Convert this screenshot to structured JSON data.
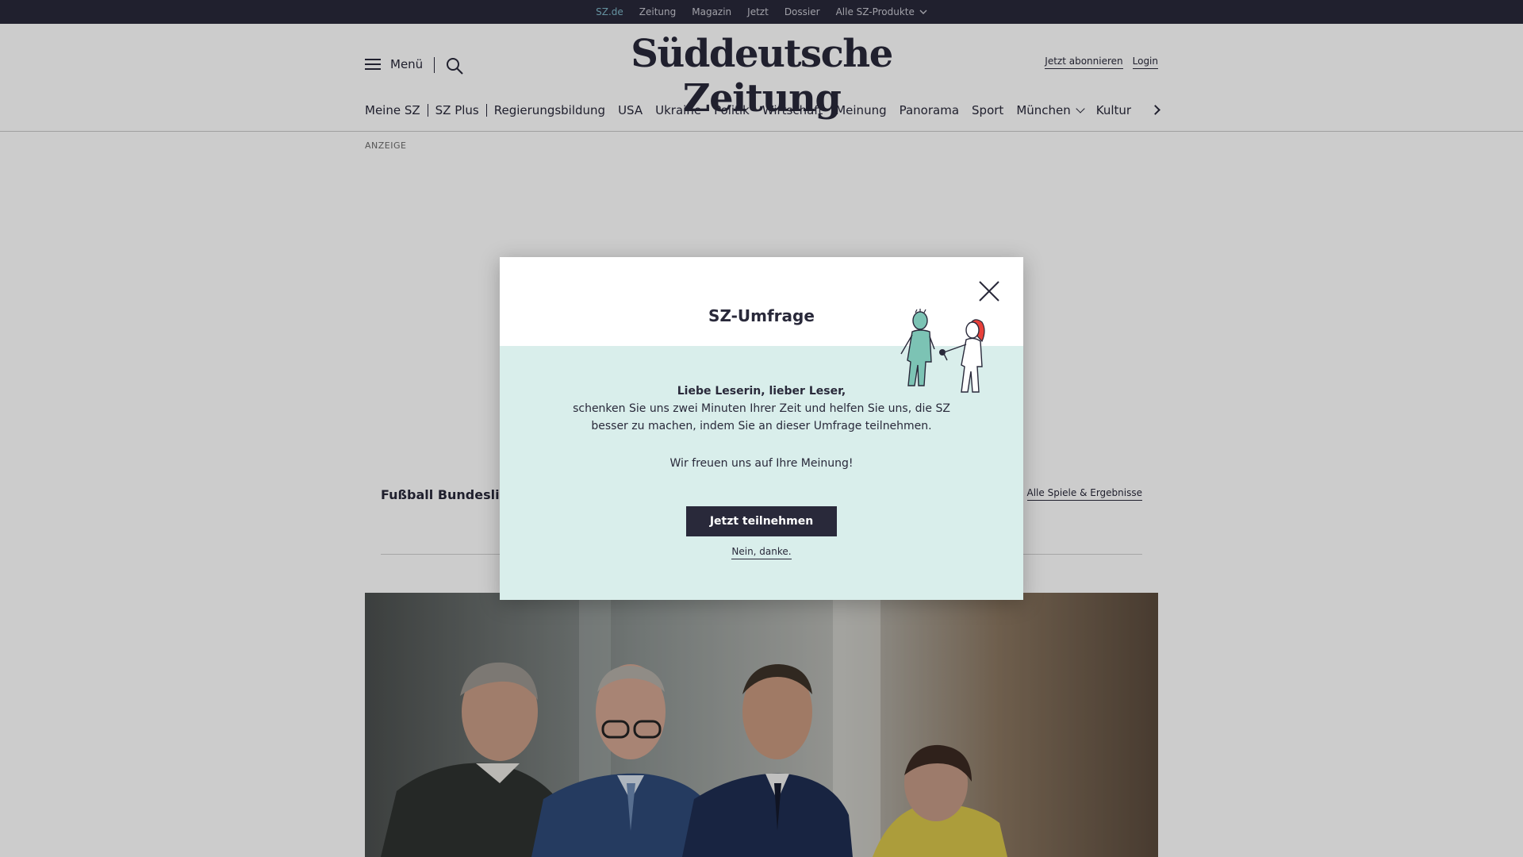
{
  "topbar": {
    "items": [
      "SZ.de",
      "Zeitung",
      "Magazin",
      "Jetzt",
      "Dossier",
      "Alle SZ-Produkte"
    ]
  },
  "header": {
    "menu_label": "Menü",
    "logo": "Süddeutsche Zeitung",
    "subscribe": "Jetzt abonnieren",
    "login": "Login"
  },
  "nav": {
    "items": [
      "Meine SZ",
      "SZ Plus",
      "Regierungsbildung",
      "USA",
      "Ukraine",
      "Politik",
      "Wirtschaft",
      "Meinung",
      "Panorama",
      "Sport",
      "München",
      "Kultur"
    ]
  },
  "content": {
    "ad_label": "ANZEIGE",
    "ticker_title": "Fußball Bundesliga",
    "ticker_link": "Alle Spiele & Ergebnisse"
  },
  "modal": {
    "title": "SZ-Umfrage",
    "greeting": "Liebe Leserin, lieber Leser,",
    "line1": "schenken Sie uns zwei Minuten Ihrer Zeit und helfen Sie uns, die SZ",
    "line2": "besser zu machen, indem Sie an dieser Umfrage teilnehmen.",
    "thanks": "Wir freuen uns auf Ihre Meinung!",
    "cta": "Jetzt teilnehmen",
    "decline": "Nein, danke."
  },
  "colors": {
    "brand_dark": "#29293a",
    "modal_body": "#d9eeeb",
    "active_link": "#7fb7c9",
    "figure_teal": "#7cc3b4",
    "figure_red": "#e8403a"
  }
}
